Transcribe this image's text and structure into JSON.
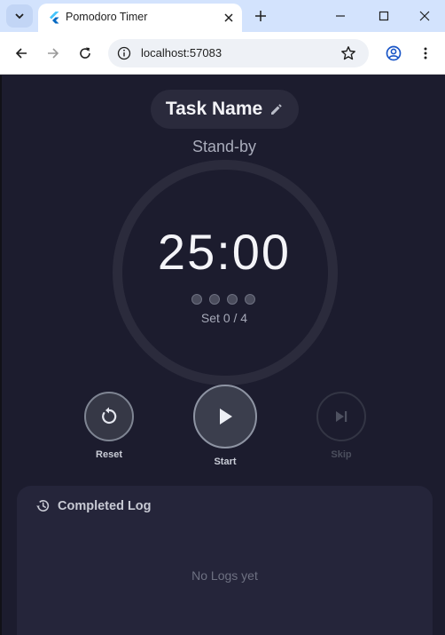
{
  "browser": {
    "tab_title": "Pomodoro Timer",
    "url": "localhost:57083"
  },
  "app": {
    "task_name": "Task Name",
    "status": "Stand-by",
    "time": "25:00",
    "set_progress": "Set 0 / 4",
    "sets_completed": 0,
    "sets_total": 4,
    "controls": {
      "reset_label": "Reset",
      "start_label": "Start",
      "skip_label": "Skip"
    },
    "log": {
      "title": "Completed Log",
      "empty_text": "No Logs yet"
    }
  },
  "icons": {
    "tab_search": "chevron-down-icon",
    "favicon": "flutter-icon",
    "edit": "pencil-icon",
    "reset": "restart-icon",
    "start": "play-icon",
    "skip": "skip-next-icon",
    "history": "history-icon"
  },
  "colors": {
    "background": "#1c1c2e",
    "card": "#25253a",
    "text_primary": "#f4f4f8",
    "text_muted": "#a9acbb"
  }
}
